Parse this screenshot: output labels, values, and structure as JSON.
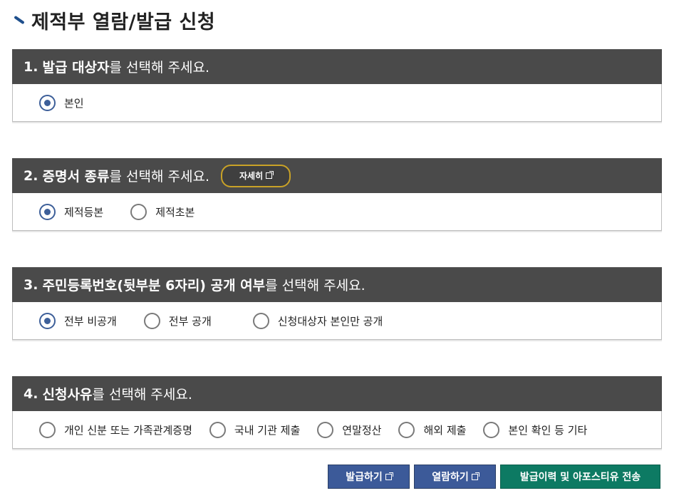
{
  "page": {
    "title": "제적부 열람/발급 신청"
  },
  "sections": [
    {
      "num": "1.",
      "strong": "발급 대상자",
      "normal": "를 선택해 주세요.",
      "options": [
        {
          "label": "본인",
          "checked": true
        }
      ]
    },
    {
      "num": "2.",
      "strong": "증명서 종류",
      "normal": "를 선택해 주세요.",
      "detail_label": "자세히",
      "options": [
        {
          "label": "제적등본",
          "checked": true
        },
        {
          "label": "제적초본",
          "checked": false
        }
      ]
    },
    {
      "num": "3.",
      "strong": "주민등록번호(뒷부분 6자리) 공개 여부",
      "normal": "를 선택해 주세요.",
      "options": [
        {
          "label": "전부 비공개",
          "checked": true
        },
        {
          "label": "전부 공개",
          "checked": false
        },
        {
          "label": "신청대상자 본인만 공개",
          "checked": false
        }
      ]
    },
    {
      "num": "4.",
      "strong": "신청사유",
      "normal": "를 선택해 주세요.",
      "options": [
        {
          "label": "개인 신분 또는 가족관계증명",
          "checked": false
        },
        {
          "label": "국내 기관 제출",
          "checked": false
        },
        {
          "label": "연말정산",
          "checked": false
        },
        {
          "label": "해외 제출",
          "checked": false
        },
        {
          "label": "본인 확인 등 기타",
          "checked": false
        }
      ]
    }
  ],
  "actions": {
    "issue_label": "발급하기",
    "view_label": "열람하기",
    "history_label": "발급이력 및 아포스티유 전송"
  },
  "colors": {
    "header_bg": "#4a4a4a",
    "radio_checked": "#3d5f99",
    "button_blue": "#3c5a99",
    "button_green": "#0d7a63",
    "detail_border": "#c9a227"
  }
}
